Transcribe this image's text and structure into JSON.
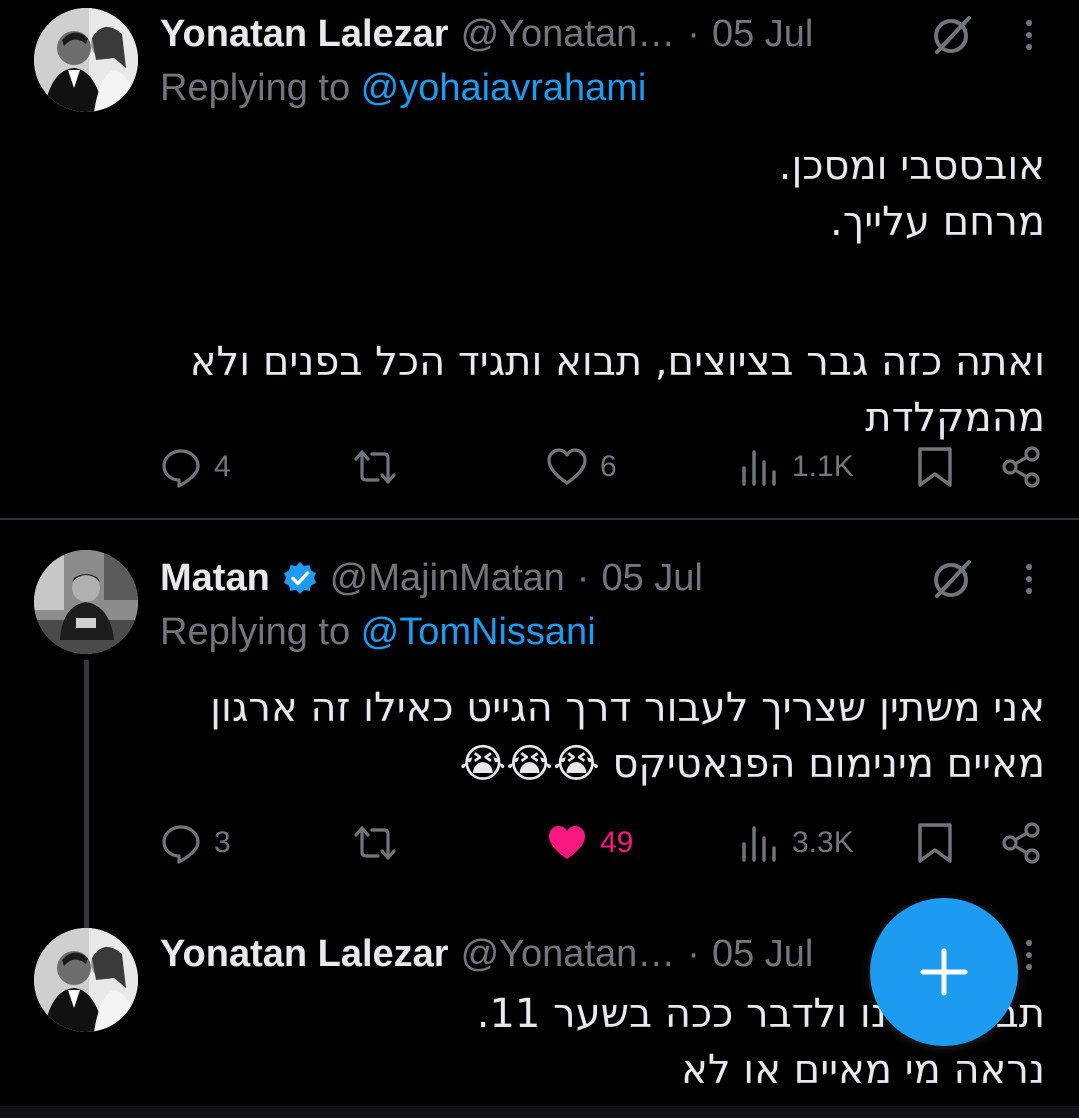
{
  "tweets": [
    {
      "name": "Yonatan Lalezar",
      "handle": "@Yonatan…",
      "date": "05 Jul",
      "replying_prefix": "Replying to ",
      "replying_to": "@yohaiavrahami",
      "lines": [
        "אובססבי ומסכן.",
        "מרחם עלייך.",
        "",
        "ואתה כזה גבר בציוצים, תבוא ותגיד הכל בפנים ולא",
        "מהמקלדת"
      ],
      "replies": "4",
      "reposts": "",
      "likes": "6",
      "views": "1.1K",
      "liked": false
    },
    {
      "name": "Matan",
      "handle": "@MajinMatan",
      "date": "05 Jul",
      "verified": true,
      "replying_prefix": "Replying to ",
      "replying_to": "@TomNissani",
      "lines": [
        "אני משתין שצריך לעבור דרך הגייט כאילו זה ארגון",
        "מאיים מינימום הפנאטיקס 😭😭😭"
      ],
      "replies": "3",
      "reposts": "",
      "likes": "49",
      "views": "3.3K",
      "liked": true
    },
    {
      "name": "Yonatan Lalezar",
      "handle": "@Yonatan…",
      "date": "05 Jul",
      "lines": [
        "תבוא אלינו ולדבר ככה בשער 11.",
        "נראה מי מאיים או לא"
      ]
    }
  ],
  "colors": {
    "background": "#000000",
    "accent": "#1d9bf0",
    "like": "#f91880",
    "muted": "#71767b"
  },
  "icons": {
    "reply": "reply-icon",
    "repost": "repost-icon",
    "like": "heart-icon",
    "views": "views-icon",
    "bookmark": "bookmark-icon",
    "share": "share-icon",
    "grok": "grok-icon",
    "more": "more-icon",
    "compose": "plus-icon"
  }
}
